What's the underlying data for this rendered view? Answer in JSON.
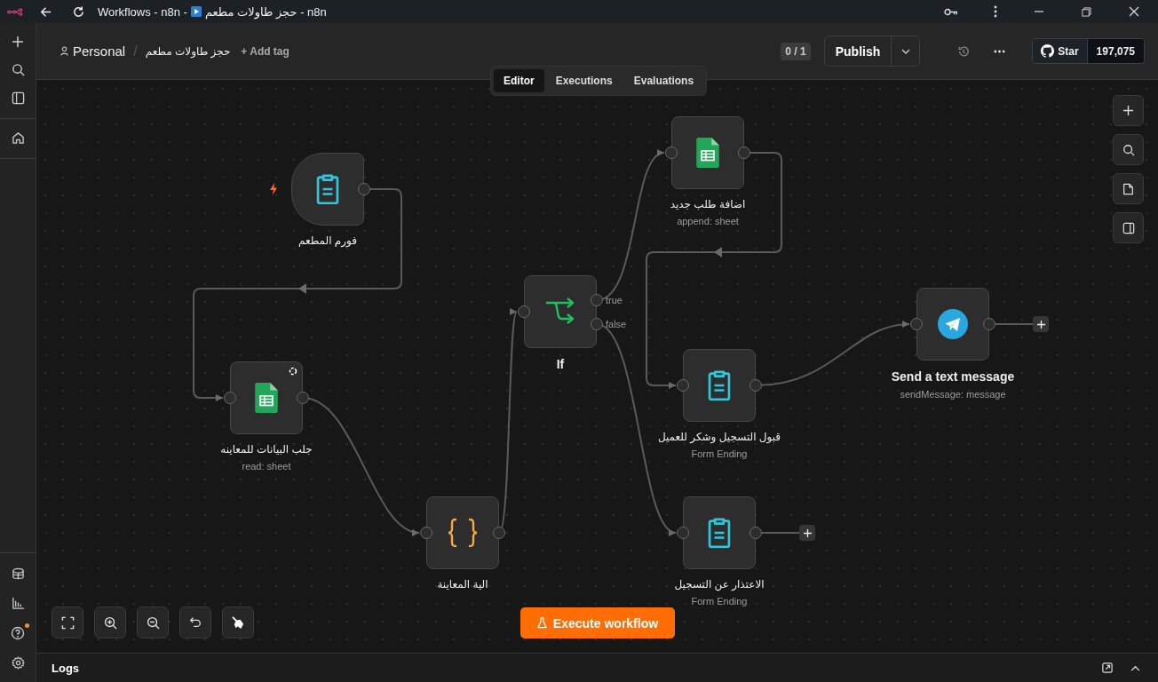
{
  "window": {
    "title_start": "Workflows - n8n -",
    "title_end": "حجز طاولات مطعم - n8n"
  },
  "header": {
    "breadcrumb": "Personal",
    "separator": "/",
    "workflow_name": "حجز طاولات مطعم",
    "add_tag": "+ Add tag",
    "counter": "0 / 1",
    "publish": "Publish",
    "github": {
      "label": "Star",
      "count": "197,075"
    }
  },
  "tabs": [
    {
      "label": "Editor",
      "selected": true
    },
    {
      "label": "Executions",
      "selected": false
    },
    {
      "label": "Evaluations",
      "selected": false
    }
  ],
  "nodes": [
    {
      "kind": "form_trigger",
      "name": "فورم المطعم",
      "refresh_badge": false,
      "open_end": false
    },
    {
      "kind": "sheets",
      "name": "جلب البيانات للمعاينه",
      "subtitle": "read: sheet",
      "refresh_badge": true,
      "open_end": false
    },
    {
      "kind": "code",
      "name": "الية المعاينة",
      "refresh_badge": false,
      "open_end": false
    },
    {
      "kind": "if",
      "name": "If",
      "outputs": [
        "true",
        "false"
      ],
      "refresh_badge": false,
      "open_end": false
    },
    {
      "kind": "sheets",
      "name": "اضافة طلب جديد",
      "subtitle": "append: sheet",
      "refresh_badge": false,
      "open_end": false
    },
    {
      "kind": "form",
      "name": "قبول التسجيل وشكر للعميل",
      "subtitle": "Form Ending",
      "refresh_badge": false,
      "open_end": false
    },
    {
      "kind": "telegram",
      "name": "Send a text message",
      "subtitle": "sendMessage: message",
      "refresh_badge": false,
      "open_end": true
    },
    {
      "kind": "form",
      "name": "الاعتذار عن التسجيل",
      "subtitle": "Form Ending",
      "refresh_badge": false,
      "open_end": true
    }
  ],
  "execute_button": "Execute workflow",
  "logs": {
    "title": "Logs"
  },
  "sidebar": {
    "help_notification": true
  }
}
